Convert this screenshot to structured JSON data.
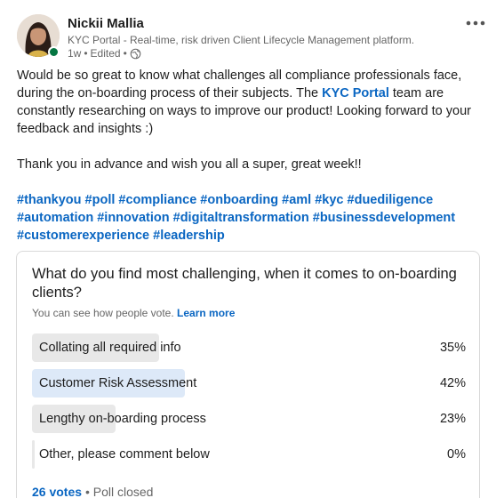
{
  "post": {
    "author": "Nickii Mallia",
    "headline": "KYC Portal - Real-time, risk driven Client Lifecycle Management platform.",
    "time": "1w",
    "edited": "Edited",
    "more_icon": "more-horizontal-icon",
    "body_part1": "Would be so great to know what challenges all compliance professionals face, during the on-boarding process of their subjects. The ",
    "body_link": "KYC Portal",
    "body_part2": " team are constantly researching on ways to improve our product! Looking forward to your feedback and insights :)",
    "body_para2": "Thank you in advance and wish you all a super, great week!!",
    "hashtags": [
      "#thankyou",
      "#poll",
      "#compliance",
      "#onboarding",
      "#aml",
      "#kyc",
      "#duediligence",
      "#automation",
      "#innovation",
      "#digitaltransformation",
      "#businessdevelopment",
      "#customerexperience",
      "#leadership"
    ]
  },
  "poll": {
    "question": "What do you find most challenging, when it comes to on-boarding clients?",
    "note": "You can see how people vote.",
    "learn_more": "Learn more",
    "options": [
      {
        "label": "Collating all required info",
        "percent": "35%",
        "fraction": 0.35,
        "selected": false
      },
      {
        "label": "Customer Risk Assessment",
        "percent": "42%",
        "fraction": 0.42,
        "selected": true
      },
      {
        "label": "Lengthy on-boarding process",
        "percent": "23%",
        "fraction": 0.23,
        "selected": false
      },
      {
        "label": "Other, please comment below",
        "percent": "0%",
        "fraction": 0.0,
        "selected": false
      }
    ],
    "votes": "26 votes",
    "separator": "•",
    "status": "Poll closed"
  },
  "colors": {
    "link": "#0a66c2",
    "selected_bar": "#dde9f8",
    "bar": "#e8e8e8",
    "presence": "#057642"
  }
}
